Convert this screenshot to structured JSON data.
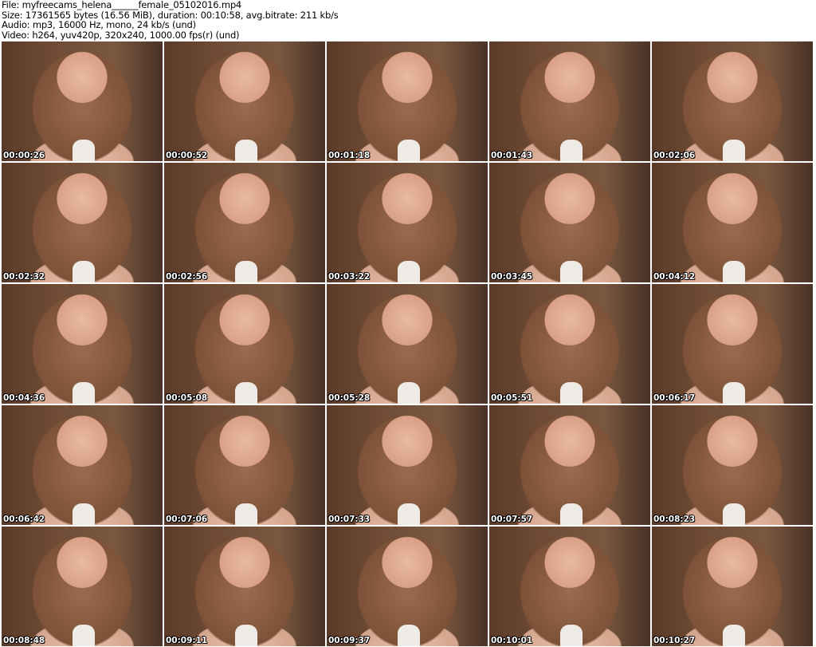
{
  "info": {
    "file": "File: myfreecams_helena______female_05102016.mp4",
    "size": "Size: 17361565 bytes (16.56 MiB), duration: 00:10:58, avg.bitrate: 211 kb/s",
    "audio": "Audio: mp3, 16000 Hz, mono, 24 kb/s (und)",
    "video": "Video: h264, yuv420p, 320x240, 1000.00 fps(r) (und)"
  },
  "thumbnails": [
    "00:00:26",
    "00:00:52",
    "00:01:18",
    "00:01:43",
    "00:02:06",
    "00:02:32",
    "00:02:56",
    "00:03:22",
    "00:03:45",
    "00:04:12",
    "00:04:36",
    "00:05:08",
    "00:05:28",
    "00:05:51",
    "00:06:17",
    "00:06:42",
    "00:07:06",
    "00:07:33",
    "00:07:57",
    "00:08:23",
    "00:08:48",
    "00:09:11",
    "00:09:37",
    "00:10:01",
    "00:10:27"
  ]
}
